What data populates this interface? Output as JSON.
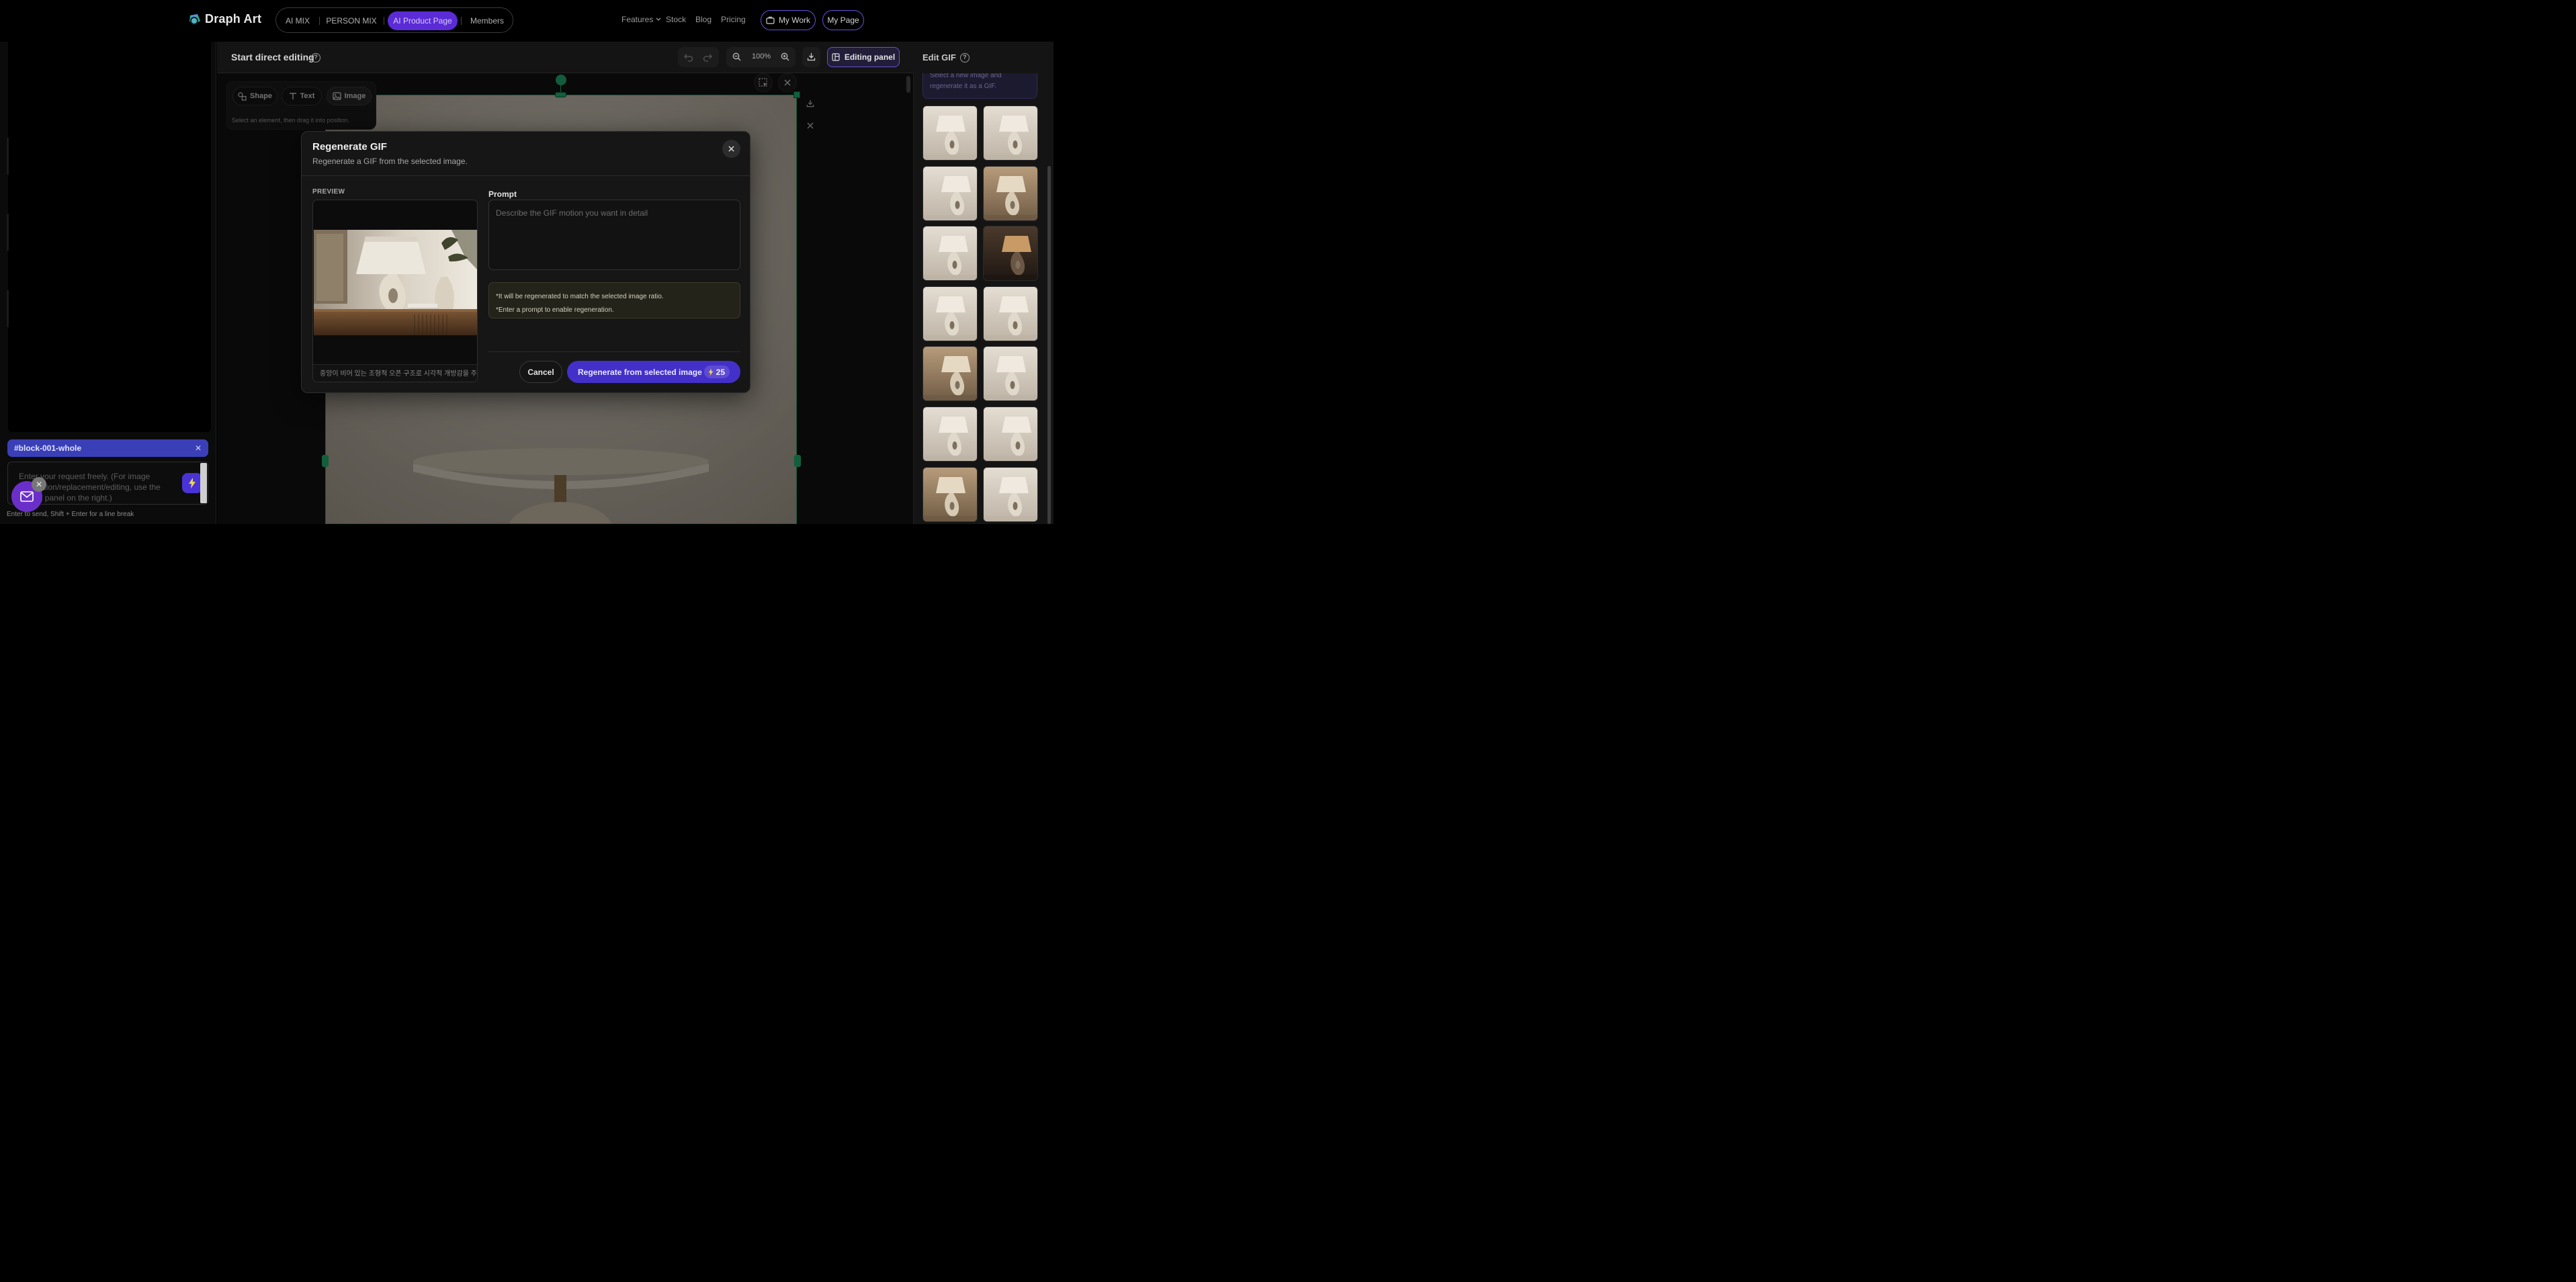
{
  "brand": {
    "name": "Draph Art"
  },
  "nav": {
    "tabs": [
      {
        "label": "AI MIX",
        "active": false
      },
      {
        "label": "PERSON MIX",
        "active": false
      },
      {
        "label": "AI Product Page",
        "active": true
      },
      {
        "label": "Members",
        "active": false
      }
    ],
    "features": "Features",
    "stock": "Stock",
    "blog": "Blog",
    "pricing": "Pricing",
    "my_work": "My Work",
    "my_page": "My Page"
  },
  "editor": {
    "title": "Start direct editing",
    "zoom": "100%",
    "editing_panel": "Editing panel",
    "tools": {
      "shape": "Shape",
      "text": "Text",
      "image": "Image"
    },
    "tools_hint": "Select an element, then drag it into position."
  },
  "left": {
    "block_tag": "#block-001-whole",
    "request_placeholder": "Enter your request freely. (For image generation/replacement/editing, use the editing panel on the right.)",
    "send_hint": "Enter to send, Shift + Enter for a line break"
  },
  "modal": {
    "title": "Regenerate GIF",
    "subtitle": "Regenerate a GIF from the selected image.",
    "preview_label": "PREVIEW",
    "preview_caption": "중앙이 비어 있는 조형적 오픈 구조로 시각적 개방감을 주...",
    "prompt_label": "Prompt",
    "prompt_placeholder": "Describe the GIF motion you want in detail",
    "note_1": "*It will be regenerated to match the selected image ratio.",
    "note_2": "*Enter a prompt to enable regeneration.",
    "cancel": "Cancel",
    "regenerate": "Regenerate from selected image",
    "credits": "25"
  },
  "right_panel": {
    "title": "Edit GIF",
    "info": "Select a new image and regenerate it as a GIF.",
    "thumbnails": [
      {
        "tone": "light"
      },
      {
        "tone": "light"
      },
      {
        "tone": "light"
      },
      {
        "tone": "warm"
      },
      {
        "tone": "light"
      },
      {
        "tone": "dark"
      },
      {
        "tone": "light"
      },
      {
        "tone": "light"
      },
      {
        "tone": "warm"
      },
      {
        "tone": "light"
      },
      {
        "tone": "light"
      },
      {
        "tone": "light"
      },
      {
        "tone": "warm"
      },
      {
        "tone": "light"
      }
    ]
  },
  "colors": {
    "accent": "#5b2bd6",
    "primary_button": "#4330c9",
    "selection": "#1fae6f",
    "chip": "#3a3fb8"
  }
}
